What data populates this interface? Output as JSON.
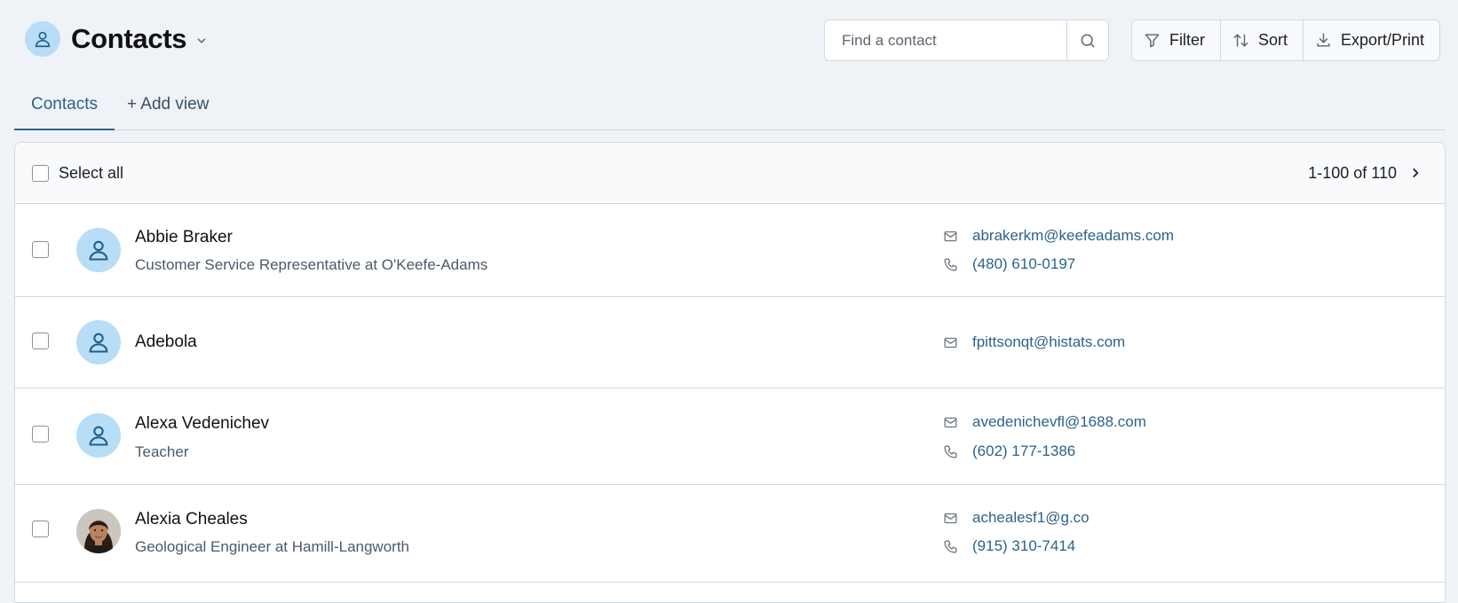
{
  "header": {
    "title": "Contacts",
    "search_placeholder": "Find a contact",
    "actions": {
      "filter": "Filter",
      "sort": "Sort",
      "export": "Export/Print"
    }
  },
  "tabs": {
    "contacts": "Contacts",
    "add_view": "+ Add view"
  },
  "list": {
    "select_all": "Select all",
    "pagination": "1-100 of 110"
  },
  "contacts": [
    {
      "name": "Abbie Braker",
      "subtitle": "Customer Service Representative at O'Keefe-Adams",
      "email": "abrakerkm@keefeadams.com",
      "phone": "(480) 610-0197",
      "avatar": "default"
    },
    {
      "name": "Adebola",
      "subtitle": "",
      "email": "fpittsonqt@histats.com",
      "phone": "",
      "avatar": "default"
    },
    {
      "name": "Alexa Vedenichev",
      "subtitle": "Teacher",
      "email": "avedenichevfl@1688.com",
      "phone": "(602) 177-1386",
      "avatar": "default"
    },
    {
      "name": "Alexia Cheales",
      "subtitle": "Geological Engineer at Hamill-Langworth",
      "email": "achealesf1@g.co",
      "phone": "(915) 310-7414",
      "avatar": "photo"
    }
  ],
  "colors": {
    "accent": "#2c6389",
    "avatar_bg": "#b8ddf6",
    "page_bg": "#eff3f7"
  }
}
